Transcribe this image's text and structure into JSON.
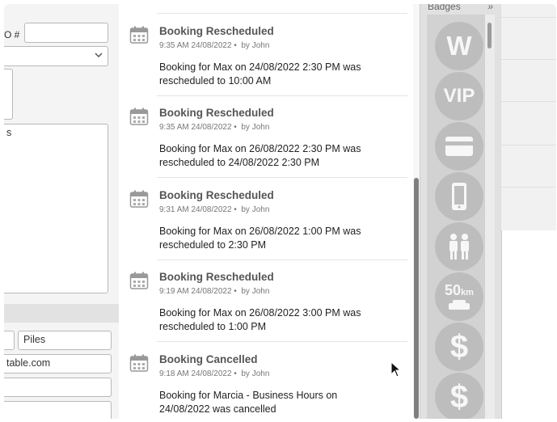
{
  "form": {
    "po_label": "O #",
    "po_value": "",
    "select_value": "",
    "notes_text": "s",
    "field_first": "",
    "field_last": "Piles",
    "field_email": "table.com"
  },
  "feed": {
    "entries": [
      {
        "title": "Booking Rescheduled",
        "time": "9:35 AM 24/08/2022",
        "author": "by John",
        "body": "Booking for Max on 24/08/2022 2:30 PM was rescheduled to 10:00 AM"
      },
      {
        "title": "Booking Rescheduled",
        "time": "9:35 AM 24/08/2022",
        "author": "by John",
        "body": "Booking for Max on 26/08/2022 2:30 PM was rescheduled to 24/08/2022 2:30 PM"
      },
      {
        "title": "Booking Rescheduled",
        "time": "9:31 AM 24/08/2022",
        "author": "by John",
        "body": "Booking for Max on 26/08/2022 1:00 PM was rescheduled to 2:30 PM"
      },
      {
        "title": "Booking Rescheduled",
        "time": "9:19 AM 24/08/2022",
        "author": "by John",
        "body": "Booking for Max on 26/08/2022 3:00 PM was rescheduled to 1:00 PM"
      },
      {
        "title": "Booking Cancelled",
        "time": "9:18 AM 24/08/2022",
        "author": "by John",
        "body": "Booking for Marcia - Business Hours on 24/08/2022 was cancelled"
      }
    ]
  },
  "badges": {
    "title": "Badges",
    "expand": "»",
    "items": [
      {
        "icon": "w-letter-icon",
        "label": "W"
      },
      {
        "icon": "vip-icon",
        "label": "VIP"
      },
      {
        "icon": "credit-card-icon",
        "label": ""
      },
      {
        "icon": "mobile-phone-icon",
        "label": ""
      },
      {
        "icon": "people-icon",
        "label": ""
      },
      {
        "icon": "distance-50km-icon",
        "label": "50",
        "unit": "km"
      },
      {
        "icon": "dollar-icon",
        "label": "$"
      },
      {
        "icon": "dollar-icon",
        "label": "$"
      }
    ]
  },
  "colors": {
    "badge_fill": "#bdbdbd",
    "scroll_thumb": "#7f7f7f",
    "feed_title": "#555555"
  }
}
